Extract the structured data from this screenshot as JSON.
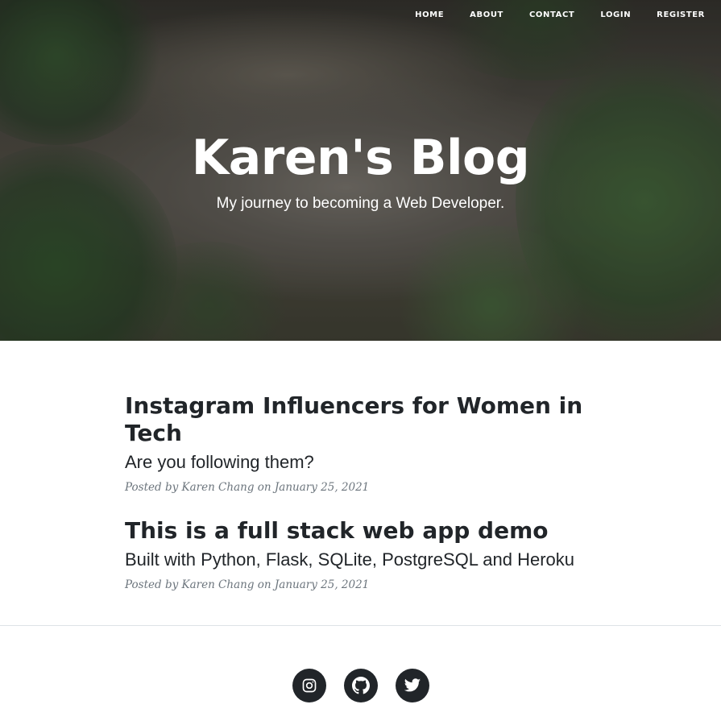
{
  "nav": {
    "items": [
      {
        "label": "HOME"
      },
      {
        "label": "ABOUT"
      },
      {
        "label": "CONTACT"
      },
      {
        "label": "LOGIN"
      },
      {
        "label": "REGISTER"
      }
    ]
  },
  "hero": {
    "title": "Karen's Blog",
    "subtitle": "My journey to becoming a Web Developer."
  },
  "posts": [
    {
      "title": "Instagram Influencers for Women in Tech",
      "subtitle": "Are you following them?",
      "meta": "Posted by Karen Chang on January 25, 2021"
    },
    {
      "title": "This is a full stack web app demo",
      "subtitle": "Built with Python, Flask, SQLite, PostgreSQL and Heroku",
      "meta": "Posted by Karen Chang on January 25, 2021"
    }
  ],
  "footer": {
    "social": [
      {
        "icon": "instagram-icon"
      },
      {
        "icon": "github-icon"
      },
      {
        "icon": "twitter-icon"
      }
    ]
  },
  "colors": {
    "text": "#212529",
    "muted": "#6c757d",
    "social_bg": "#212529"
  }
}
